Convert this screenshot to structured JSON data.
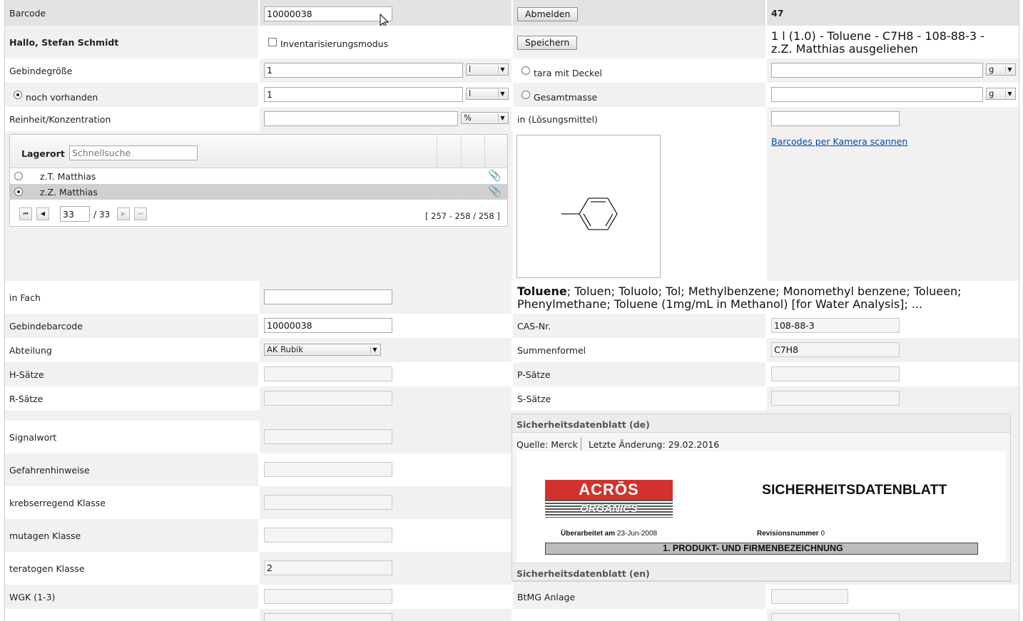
{
  "header": {
    "barcode_label": "Barcode",
    "barcode_value": "10000038",
    "logout_label": "Abmelden",
    "count": "47"
  },
  "greeting": {
    "text": "Hallo, Stefan Schmidt",
    "inventory_mode_label": "Inventarisierungsmodus",
    "save_label": "Speichern",
    "summary_line1": "1 l (1.0) - Toluene - C7H8 - 108-88-3 -",
    "summary_line2": "z.Z. Matthias ausgeliehen"
  },
  "container": {
    "size_label": "Gebindegröße",
    "size_value": "1",
    "size_unit": "l",
    "tare_label": "tara mit Deckel",
    "tare_unit": "g",
    "remaining_label": "noch vorhanden",
    "remaining_value": "1",
    "remaining_unit": "l",
    "total_mass_label": "Gesamtmasse",
    "total_mass_unit": "g",
    "purity_label": "Reinheit/Konzentration",
    "purity_unit": "%",
    "solvent_label": "in (Lösungsmittel)"
  },
  "storage": {
    "column_label": "Lagerort",
    "search_placeholder": "Schnellsuche",
    "rows": [
      {
        "name": "z.T. Matthias",
        "selected": false
      },
      {
        "name": "z.Z. Matthias",
        "selected": true
      }
    ],
    "page_current": "33",
    "page_total": "/ 33",
    "range": "[ 257 - 258 / 258 ]"
  },
  "camera_link": "Barcodes per Kamera scannen",
  "synonyms": {
    "main": "Toluene",
    "rest_line1": "; Toluen; Toluolo; Tol; Methylbenzene; Monomethyl benzene; Tolueen;",
    "line2": "Phenylmethane; Toluene (1mg/mL in Methanol) [for Water Analysis]; ..."
  },
  "fields": {
    "compartment_label": "in Fach",
    "container_barcode_label": "Gebindebarcode",
    "container_barcode_value": "10000038",
    "cas_label": "CAS-Nr.",
    "cas_value": "108-88-3",
    "department_label": "Abteilung",
    "department_value": "AK Rubik",
    "formula_label": "Summenformel",
    "formula_value": "C7H8",
    "h_label": "H-Sätze",
    "p_label": "P-Sätze",
    "r_label": "R-Sätze",
    "s_label": "S-Sätze",
    "signal_label": "Signalwort",
    "hazard_label": "Gefahrenhinweise",
    "carc_label": "krebserregend Klasse",
    "mut_label": "mutagen Klasse",
    "terat_label": "teratogen Klasse",
    "terat_value": "2",
    "wgk_label": "WGK (1-3)",
    "btmg_label": "BtMG Anlage"
  },
  "sdb": {
    "de_title": "Sicherheitsdatenblatt (de)",
    "source": "Quelle: Merck",
    "last_change": "Letzte Änderung: 29.02.2016",
    "logo_top": "ACRŌS",
    "logo_bottom": "ORGANICS",
    "doc_title": "SICHERHEITSDATENBLATT",
    "revised_label": "Überarbeitet am",
    "revised_date": "23-Jun-2008",
    "revision_label": "Revisionsnummer",
    "revision_value": "0",
    "section": "1.  PRODUKT- UND FIRMENBEZEICHNUNG",
    "en_title": "Sicherheitsdatenblatt (en)"
  },
  "colors": {
    "row_gray": "#f1f1f1",
    "header_gray": "#e3e3e3",
    "link_blue": "#0645ad",
    "acros_red": "#d2322d"
  }
}
